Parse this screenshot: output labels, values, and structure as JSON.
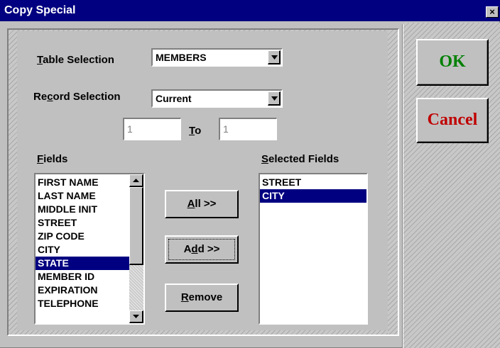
{
  "window": {
    "title": "Copy Special",
    "close_glyph": "×"
  },
  "table_selection": {
    "label_u": "T",
    "label_rest": "able Selection",
    "value": "MEMBERS"
  },
  "record_selection": {
    "label_pre": "Re",
    "label_u": "c",
    "label_rest": "ord Selection",
    "value": "Current"
  },
  "range": {
    "from": "1",
    "to_u": "T",
    "to_rest": "o",
    "to": "1"
  },
  "fields": {
    "label_u": "F",
    "label_rest": "ields",
    "items": [
      "FIRST NAME",
      "LAST NAME",
      "MIDDLE INIT",
      "STREET",
      "ZIP CODE",
      "CITY",
      "STATE",
      "MEMBER ID",
      "EXPIRATION",
      "TELEPHONE"
    ],
    "selected_index": 6
  },
  "selected_fields": {
    "label_u": "S",
    "label_rest": "elected Fields",
    "items": [
      "STREET",
      "CITY"
    ],
    "selected_index": 1
  },
  "buttons": {
    "all": {
      "u": "A",
      "rest": "ll >>"
    },
    "add": {
      "pre": "A",
      "u": "d",
      "rest": "d >>"
    },
    "remove": {
      "u": "R",
      "rest": "emove"
    },
    "ok": "OK",
    "cancel": "Cancel"
  },
  "colors": {
    "titlebar": "#000080",
    "ok_text": "#008000",
    "cancel_text": "#c00000",
    "selection": "#000080"
  }
}
